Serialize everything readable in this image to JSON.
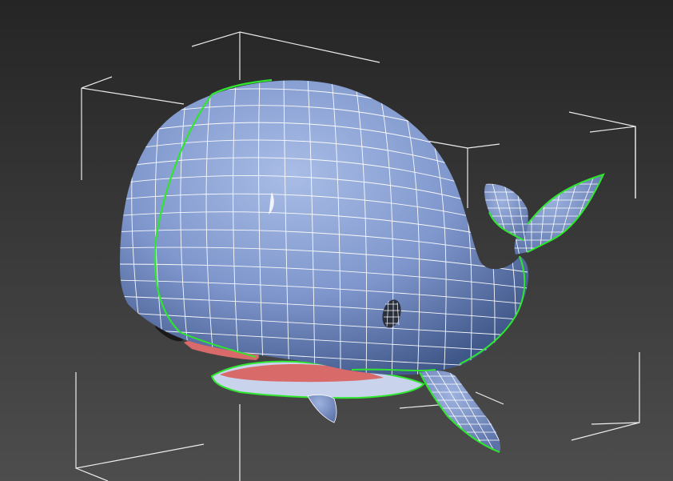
{
  "scene": {
    "background_top": "#262626",
    "background_bottom": "#4c4c4c",
    "mesh_color": "#7e96cc",
    "mesh_highlight": "#a9bde6",
    "mesh_shadow": "#3f5688",
    "wire_color": "#ffffff",
    "edge_selection_color": "#2ee62e",
    "mouth_color": "#d86a6a",
    "bounding_box_color": "#ffffff"
  },
  "objects": [
    {
      "name": "whale-body",
      "selected": true
    }
  ]
}
